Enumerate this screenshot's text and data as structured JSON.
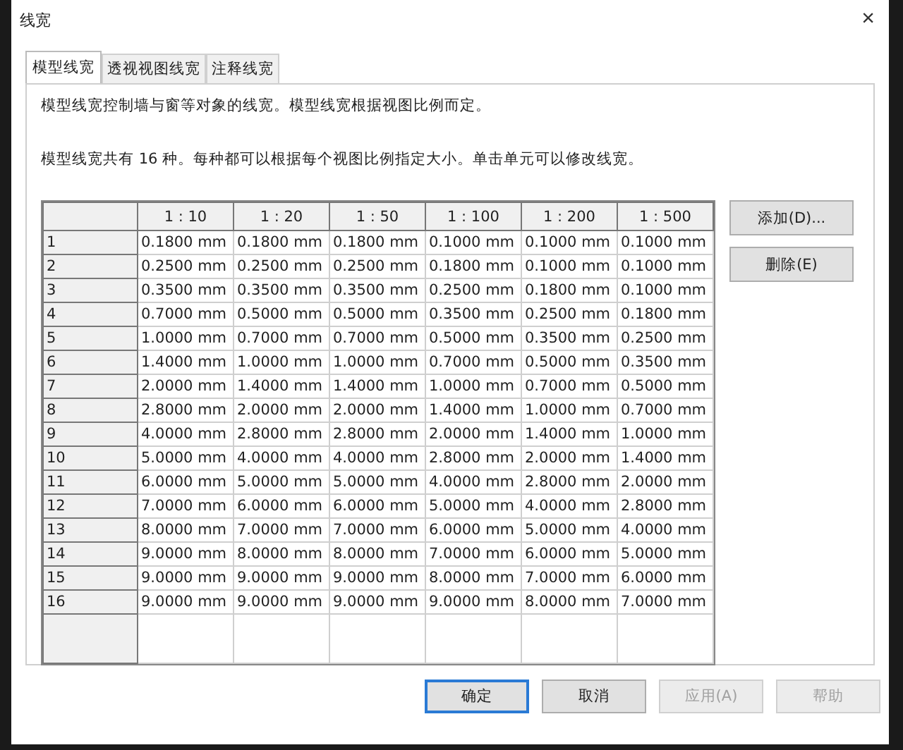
{
  "window": {
    "title": "线宽",
    "close": "×"
  },
  "tabs": [
    {
      "label": "模型线宽",
      "selected": true
    },
    {
      "label": "透视视图线宽",
      "selected": false
    },
    {
      "label": "注释线宽",
      "selected": false
    }
  ],
  "description": [
    "模型线宽控制墙与窗等对象的线宽。模型线宽根据视图比例而定。",
    "模型线宽共有 16 种。每种都可以根据每个视图比例指定大小。单击单元可以修改线宽。"
  ],
  "table": {
    "columns": [
      "1 : 10",
      "1 : 20",
      "1 : 50",
      "1 : 100",
      "1 : 200",
      "1 : 500"
    ],
    "rows": [
      {
        "label": "1",
        "cells": [
          "0.1800 mm",
          "0.1800 mm",
          "0.1800 mm",
          "0.1000 mm",
          "0.1000 mm",
          "0.1000 mm"
        ]
      },
      {
        "label": "2",
        "cells": [
          "0.2500 mm",
          "0.2500 mm",
          "0.2500 mm",
          "0.1800 mm",
          "0.1000 mm",
          "0.1000 mm"
        ]
      },
      {
        "label": "3",
        "cells": [
          "0.3500 mm",
          "0.3500 mm",
          "0.3500 mm",
          "0.2500 mm",
          "0.1800 mm",
          "0.1000 mm"
        ]
      },
      {
        "label": "4",
        "cells": [
          "0.7000 mm",
          "0.5000 mm",
          "0.5000 mm",
          "0.3500 mm",
          "0.2500 mm",
          "0.1800 mm"
        ]
      },
      {
        "label": "5",
        "cells": [
          "1.0000 mm",
          "0.7000 mm",
          "0.7000 mm",
          "0.5000 mm",
          "0.3500 mm",
          "0.2500 mm"
        ]
      },
      {
        "label": "6",
        "cells": [
          "1.4000 mm",
          "1.0000 mm",
          "1.0000 mm",
          "0.7000 mm",
          "0.5000 mm",
          "0.3500 mm"
        ]
      },
      {
        "label": "7",
        "cells": [
          "2.0000 mm",
          "1.4000 mm",
          "1.4000 mm",
          "1.0000 mm",
          "0.7000 mm",
          "0.5000 mm"
        ]
      },
      {
        "label": "8",
        "cells": [
          "2.8000 mm",
          "2.0000 mm",
          "2.0000 mm",
          "1.4000 mm",
          "1.0000 mm",
          "0.7000 mm"
        ]
      },
      {
        "label": "9",
        "cells": [
          "4.0000 mm",
          "2.8000 mm",
          "2.8000 mm",
          "2.0000 mm",
          "1.4000 mm",
          "1.0000 mm"
        ]
      },
      {
        "label": "10",
        "cells": [
          "5.0000 mm",
          "4.0000 mm",
          "4.0000 mm",
          "2.8000 mm",
          "2.0000 mm",
          "1.4000 mm"
        ]
      },
      {
        "label": "11",
        "cells": [
          "6.0000 mm",
          "5.0000 mm",
          "5.0000 mm",
          "4.0000 mm",
          "2.8000 mm",
          "2.0000 mm"
        ]
      },
      {
        "label": "12",
        "cells": [
          "7.0000 mm",
          "6.0000 mm",
          "6.0000 mm",
          "5.0000 mm",
          "4.0000 mm",
          "2.8000 mm"
        ]
      },
      {
        "label": "13",
        "cells": [
          "8.0000 mm",
          "7.0000 mm",
          "7.0000 mm",
          "6.0000 mm",
          "5.0000 mm",
          "4.0000 mm"
        ]
      },
      {
        "label": "14",
        "cells": [
          "9.0000 mm",
          "8.0000 mm",
          "8.0000 mm",
          "7.0000 mm",
          "6.0000 mm",
          "5.0000 mm"
        ]
      },
      {
        "label": "15",
        "cells": [
          "9.0000 mm",
          "9.0000 mm",
          "9.0000 mm",
          "8.0000 mm",
          "7.0000 mm",
          "6.0000 mm"
        ]
      },
      {
        "label": "16",
        "cells": [
          "9.0000 mm",
          "9.0000 mm",
          "9.0000 mm",
          "9.0000 mm",
          "8.0000 mm",
          "7.0000 mm"
        ]
      }
    ]
  },
  "side_buttons": [
    {
      "label": "添加(D)..."
    },
    {
      "label": "删除(E)"
    }
  ],
  "footer_buttons": [
    {
      "label": "确定",
      "default": true,
      "disabled": false
    },
    {
      "label": "取消",
      "default": false,
      "disabled": false
    },
    {
      "label": "应用(A)",
      "default": false,
      "disabled": true
    },
    {
      "label": "帮助",
      "default": false,
      "disabled": true
    }
  ]
}
